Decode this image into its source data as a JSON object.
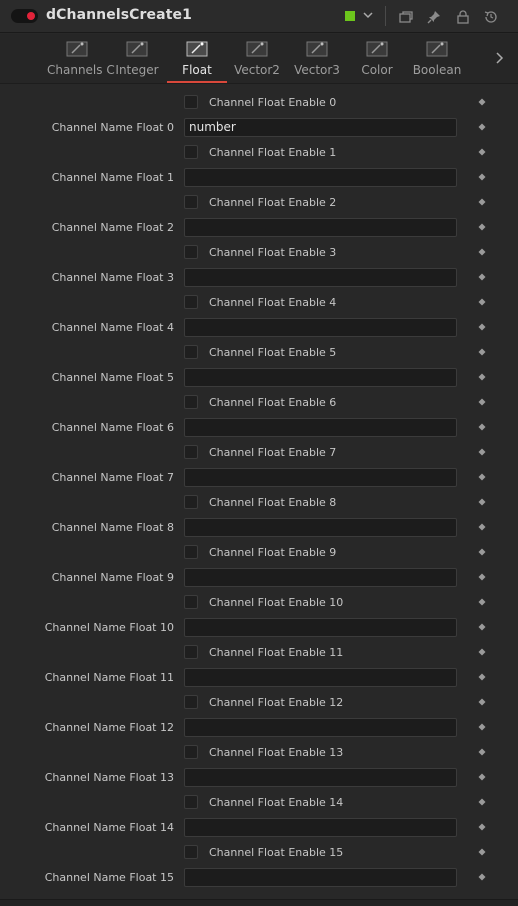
{
  "header": {
    "title": "dChannelsCreate1",
    "tool_color": "#6cc51c",
    "enable_toggle_color": "#e2233a",
    "icons": [
      "enable-toggle-icon",
      "chevron-down-icon",
      "versions-icon",
      "pin-icon",
      "lock-icon",
      "reset-icon"
    ]
  },
  "tabs": [
    {
      "label": "Channels C",
      "icon": "tool-tab-icon",
      "active": false
    },
    {
      "label": "Integer",
      "icon": "tool-tab-icon",
      "active": false
    },
    {
      "label": "Float",
      "icon": "tool-tab-icon",
      "active": true
    },
    {
      "label": "Vector2",
      "icon": "tool-tab-icon",
      "active": false
    },
    {
      "label": "Vector3",
      "icon": "tool-tab-icon",
      "active": false
    },
    {
      "label": "Color",
      "icon": "tool-tab-icon",
      "active": false
    },
    {
      "label": "Boolean",
      "icon": "tool-tab-icon",
      "active": false
    }
  ],
  "accent_color": "#d9483b",
  "float_channels": [
    {
      "enable_label": "Channel Float Enable 0",
      "enabled": false,
      "name_label": "Channel Name Float 0",
      "name_value": "number"
    },
    {
      "enable_label": "Channel Float Enable 1",
      "enabled": false,
      "name_label": "Channel Name Float 1",
      "name_value": ""
    },
    {
      "enable_label": "Channel Float Enable 2",
      "enabled": false,
      "name_label": "Channel Name Float 2",
      "name_value": ""
    },
    {
      "enable_label": "Channel Float Enable 3",
      "enabled": false,
      "name_label": "Channel Name Float 3",
      "name_value": ""
    },
    {
      "enable_label": "Channel Float Enable 4",
      "enabled": false,
      "name_label": "Channel Name Float 4",
      "name_value": ""
    },
    {
      "enable_label": "Channel Float Enable 5",
      "enabled": false,
      "name_label": "Channel Name Float 5",
      "name_value": ""
    },
    {
      "enable_label": "Channel Float Enable 6",
      "enabled": false,
      "name_label": "Channel Name Float 6",
      "name_value": ""
    },
    {
      "enable_label": "Channel Float Enable 7",
      "enabled": false,
      "name_label": "Channel Name Float 7",
      "name_value": ""
    },
    {
      "enable_label": "Channel Float Enable 8",
      "enabled": false,
      "name_label": "Channel Name Float 8",
      "name_value": ""
    },
    {
      "enable_label": "Channel Float Enable 9",
      "enabled": false,
      "name_label": "Channel Name Float 9",
      "name_value": ""
    },
    {
      "enable_label": "Channel Float Enable 10",
      "enabled": false,
      "name_label": "Channel Name Float 10",
      "name_value": ""
    },
    {
      "enable_label": "Channel Float Enable 11",
      "enabled": false,
      "name_label": "Channel Name Float 11",
      "name_value": ""
    },
    {
      "enable_label": "Channel Float Enable 12",
      "enabled": false,
      "name_label": "Channel Name Float 12",
      "name_value": ""
    },
    {
      "enable_label": "Channel Float Enable 13",
      "enabled": false,
      "name_label": "Channel Name Float 13",
      "name_value": ""
    },
    {
      "enable_label": "Channel Float Enable 14",
      "enabled": false,
      "name_label": "Channel Name Float 14",
      "name_value": ""
    },
    {
      "enable_label": "Channel Float Enable 15",
      "enabled": false,
      "name_label": "Channel Name Float 15",
      "name_value": ""
    }
  ]
}
